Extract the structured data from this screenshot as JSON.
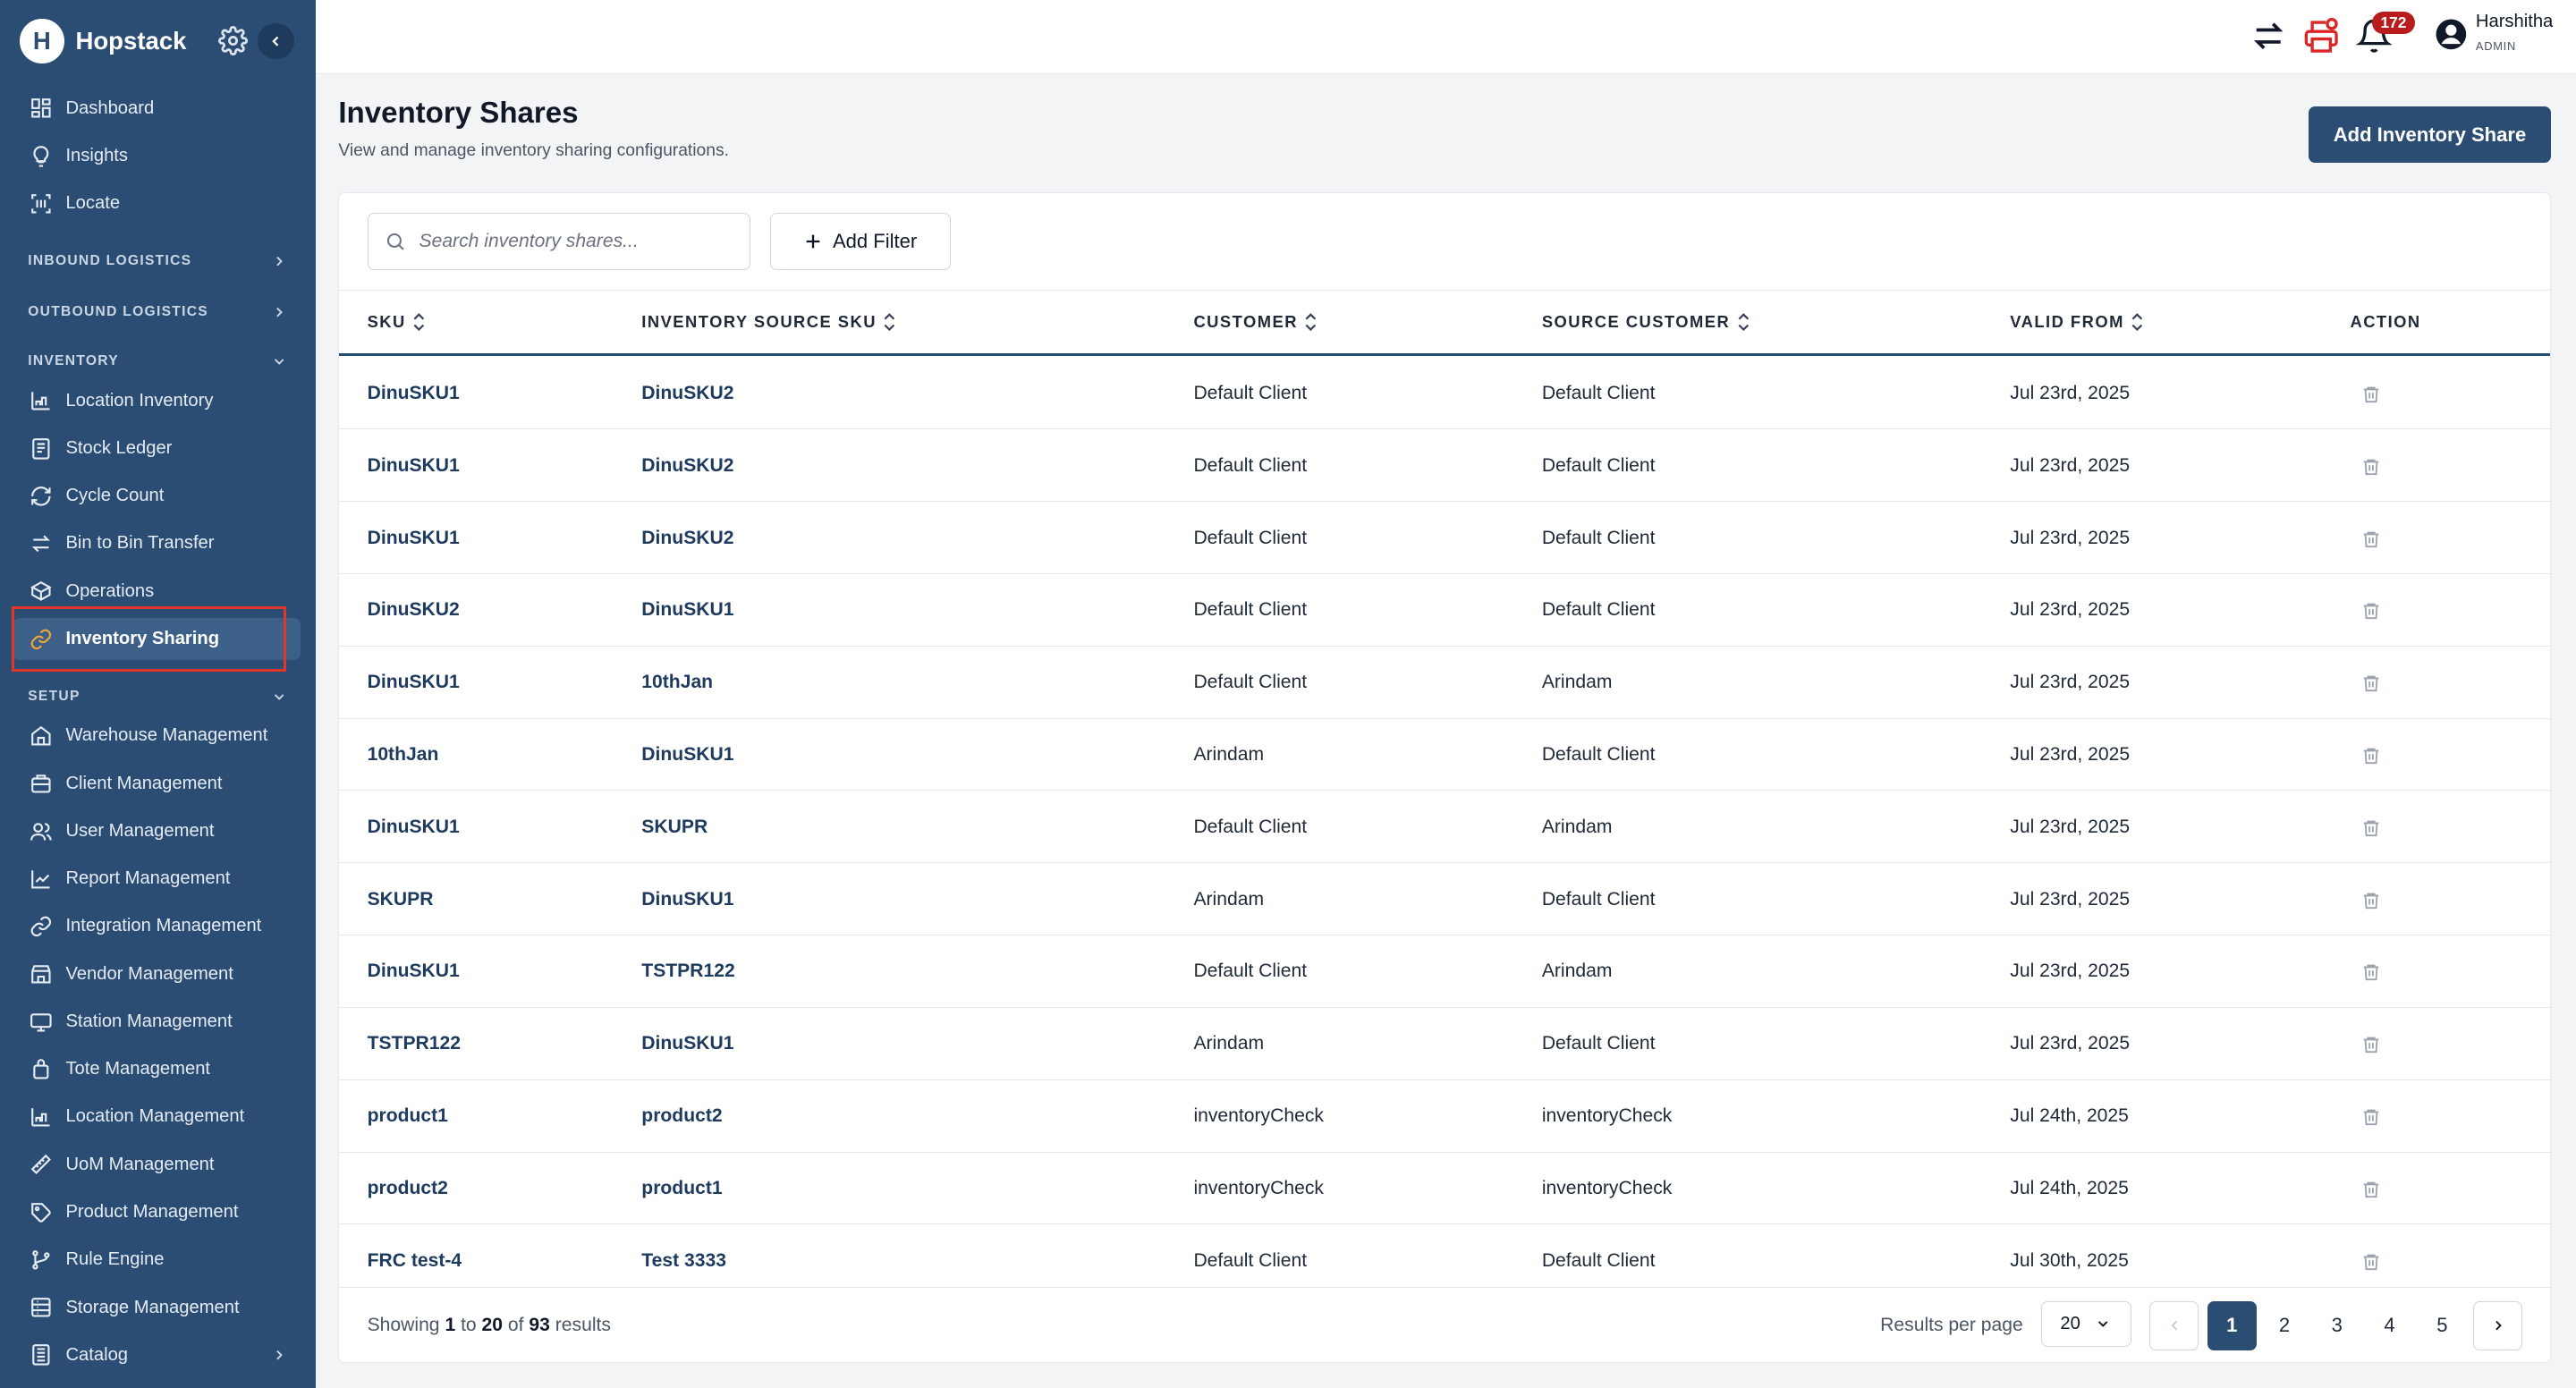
{
  "brand": {
    "name": "Hopstack",
    "logo_letter": "H"
  },
  "sidebar": {
    "top_items": [
      {
        "label": "Dashboard",
        "icon": "dashboard-icon"
      },
      {
        "label": "Insights",
        "icon": "lightbulb-icon"
      },
      {
        "label": "Locate",
        "icon": "scan-icon"
      }
    ],
    "sections": {
      "inbound": "INBOUND LOGISTICS",
      "outbound": "OUTBOUND LOGISTICS",
      "inventory": "INVENTORY",
      "setup": "SETUP"
    },
    "inventory_items": [
      {
        "label": "Location Inventory",
        "icon": "warehouse-icon"
      },
      {
        "label": "Stock Ledger",
        "icon": "ledger-icon"
      },
      {
        "label": "Cycle Count",
        "icon": "refresh-icon"
      },
      {
        "label": "Bin to Bin Transfer",
        "icon": "transfer-icon"
      },
      {
        "label": "Operations",
        "icon": "box-icon"
      },
      {
        "label": "Inventory Sharing",
        "icon": "link-icon",
        "active": true
      }
    ],
    "setup_items": [
      {
        "label": "Warehouse Management",
        "icon": "home-icon"
      },
      {
        "label": "Client Management",
        "icon": "briefcase-icon"
      },
      {
        "label": "User Management",
        "icon": "users-icon"
      },
      {
        "label": "Report Management",
        "icon": "chart-icon"
      },
      {
        "label": "Integration Management",
        "icon": "link-icon"
      },
      {
        "label": "Vendor Management",
        "icon": "store-icon"
      },
      {
        "label": "Station Management",
        "icon": "monitor-icon"
      },
      {
        "label": "Tote Management",
        "icon": "bag-icon"
      },
      {
        "label": "Location Management",
        "icon": "warehouse-icon"
      },
      {
        "label": "UoM Management",
        "icon": "ruler-icon"
      },
      {
        "label": "Product Management",
        "icon": "tag-icon"
      },
      {
        "label": "Rule Engine",
        "icon": "branch-icon"
      },
      {
        "label": "Storage Management",
        "icon": "storage-icon"
      },
      {
        "label": "Catalog",
        "icon": "catalog-icon"
      }
    ]
  },
  "topbar": {
    "notification_count": "172",
    "user_name": "Harshitha",
    "user_role": "ADMIN"
  },
  "header": {
    "title": "Inventory Shares",
    "subtitle": "View and manage inventory sharing configurations.",
    "add_button": "Add Inventory Share"
  },
  "toolbar": {
    "search_placeholder": "Search inventory shares...",
    "filter_label": "Add Filter"
  },
  "table": {
    "columns": [
      "SKU",
      "INVENTORY SOURCE SKU",
      "CUSTOMER",
      "SOURCE CUSTOMER",
      "VALID FROM",
      "ACTION"
    ],
    "rows": [
      [
        "DinuSKU1",
        "DinuSKU2",
        "Default Client",
        "Default Client",
        "Jul 23rd, 2025"
      ],
      [
        "DinuSKU1",
        "DinuSKU2",
        "Default Client",
        "Default Client",
        "Jul 23rd, 2025"
      ],
      [
        "DinuSKU1",
        "DinuSKU2",
        "Default Client",
        "Default Client",
        "Jul 23rd, 2025"
      ],
      [
        "DinuSKU2",
        "DinuSKU1",
        "Default Client",
        "Default Client",
        "Jul 23rd, 2025"
      ],
      [
        "DinuSKU1",
        "10thJan",
        "Default Client",
        "Arindam",
        "Jul 23rd, 2025"
      ],
      [
        "10thJan",
        "DinuSKU1",
        "Arindam",
        "Default Client",
        "Jul 23rd, 2025"
      ],
      [
        "DinuSKU1",
        "SKUPR",
        "Default Client",
        "Arindam",
        "Jul 23rd, 2025"
      ],
      [
        "SKUPR",
        "DinuSKU1",
        "Arindam",
        "Default Client",
        "Jul 23rd, 2025"
      ],
      [
        "DinuSKU1",
        "TSTPR122",
        "Default Client",
        "Arindam",
        "Jul 23rd, 2025"
      ],
      [
        "TSTPR122",
        "DinuSKU1",
        "Arindam",
        "Default Client",
        "Jul 23rd, 2025"
      ],
      [
        "product1",
        "product2",
        "inventoryCheck",
        "inventoryCheck",
        "Jul 24th, 2025"
      ],
      [
        "product2",
        "product1",
        "inventoryCheck",
        "inventoryCheck",
        "Jul 24th, 2025"
      ],
      [
        "FRC test-4",
        "Test 3333",
        "Default Client",
        "Default Client",
        "Jul 30th, 2025"
      ]
    ]
  },
  "pagination": {
    "showing_prefix": "Showing",
    "from": "1",
    "to_word": "to",
    "to": "20",
    "of_word": "of",
    "total": "93",
    "results_word": "results",
    "rpp_label": "Results per page",
    "rpp_value": "20",
    "pages": [
      "1",
      "2",
      "3",
      "4",
      "5"
    ],
    "current_page": "1"
  },
  "colors": {
    "sidebar": "#2c4d73",
    "primary": "#2c4d73",
    "highlight_box": "#e2362a",
    "badge": "#b91c1c"
  }
}
